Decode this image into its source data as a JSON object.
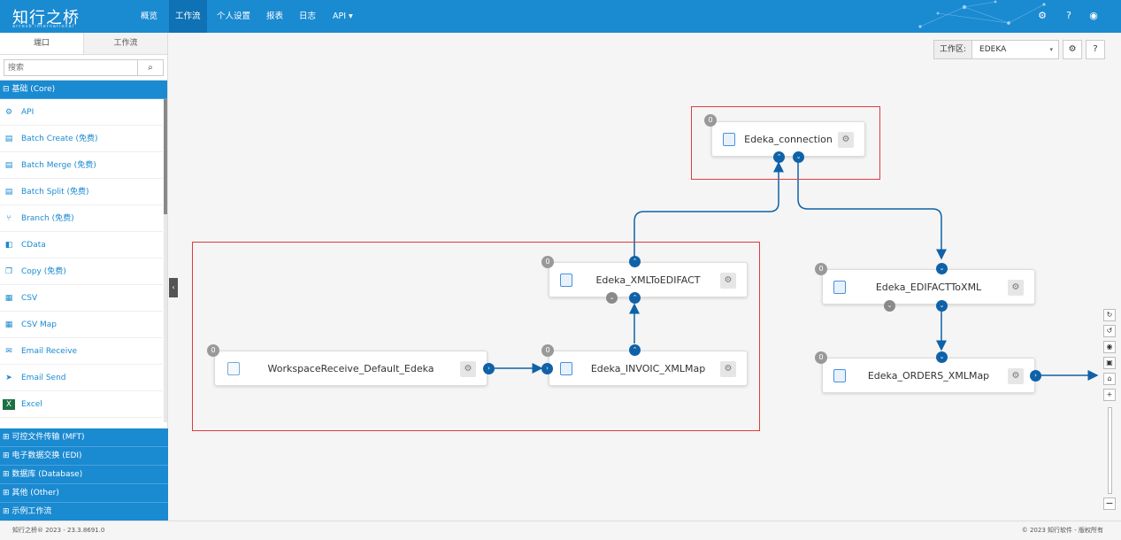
{
  "topbar": {
    "logo": "知行之桥",
    "logo_sub": "arcesb international",
    "nav": [
      "概览",
      "工作流",
      "个人设置",
      "报表",
      "日志",
      "API ▾"
    ],
    "active_nav": "工作流",
    "icons": [
      "gear-icon",
      "help-icon",
      "user-icon"
    ]
  },
  "sidebar": {
    "tabs": [
      "端口",
      "工作流"
    ],
    "search_placeholder": "搜索",
    "core_category": "⊟ 基础 (Core)",
    "items": [
      {
        "label": "API",
        "icon": "api-icon"
      },
      {
        "label": "Batch Create (免费)",
        "icon": "batch-create-icon"
      },
      {
        "label": "Batch Merge (免费)",
        "icon": "batch-merge-icon"
      },
      {
        "label": "Batch Split (免费)",
        "icon": "batch-split-icon"
      },
      {
        "label": "Branch (免费)",
        "icon": "branch-icon"
      },
      {
        "label": "CData",
        "icon": "cdata-icon"
      },
      {
        "label": "Copy (免费)",
        "icon": "copy-icon"
      },
      {
        "label": "CSV",
        "icon": "csv-icon"
      },
      {
        "label": "CSV Map",
        "icon": "csv-map-icon"
      },
      {
        "label": "Email Receive",
        "icon": "email-receive-icon"
      },
      {
        "label": "Email Send",
        "icon": "email-send-icon"
      },
      {
        "label": "Excel",
        "icon": "excel-icon"
      }
    ],
    "other_categories": [
      "⊞ 可控文件传输 (MFT)",
      "⊞ 电子数据交换 (EDI)",
      "⊞ 数据库 (Database)",
      "⊞ 其他 (Other)",
      "⊞ 示例工作流"
    ]
  },
  "workspace": {
    "label": "工作区:",
    "value": "EDEKA"
  },
  "nodes": [
    {
      "name": "Edeka_connection",
      "badge": "0"
    },
    {
      "name": "Edeka_XMLToEDIFACT",
      "badge": "0"
    },
    {
      "name": "WorkspaceReceive_Default_Edeka",
      "badge": "0"
    },
    {
      "name": "Edeka_INVOIC_XMLMap",
      "badge": "0"
    },
    {
      "name": "Edeka_EDIFACTToXML",
      "badge": "0"
    },
    {
      "name": "Edeka_ORDERS_XMLMap",
      "badge": "0"
    }
  ],
  "footer": {
    "left": "知行之桥® 2023 - 23.3.8691.0",
    "right": "© 2023 知行软件 - 版权所有"
  },
  "colors": {
    "brand": "#1a8ad1",
    "port": "#0f62a8",
    "highlight": "#e03a3a"
  }
}
